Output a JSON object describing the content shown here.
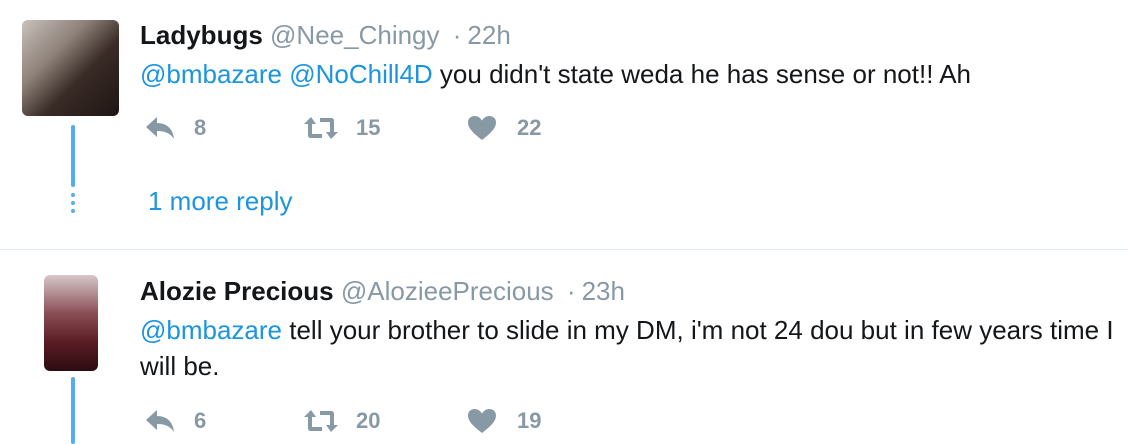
{
  "tweets": [
    {
      "name": "Ladybugs",
      "handle": "@Nee_Chingy",
      "separator": "·",
      "time": "22h",
      "mentions": [
        "@bmbazare",
        "@NoChill4D"
      ],
      "text": "you didn't state weda he has sense or not!! Ah",
      "replies": "8",
      "retweets": "15",
      "likes": "22",
      "more_replies": "1 more reply"
    },
    {
      "name": "Alozie Precious",
      "handle": "@AlozieePrecious",
      "separator": "·",
      "time": "23h",
      "mentions": [
        "@bmbazare"
      ],
      "text": "tell your brother to slide in my DM, i'm not 24 dou but in few years time I will be.",
      "replies": "6",
      "retweets": "20",
      "likes": "19"
    }
  ],
  "colors": {
    "link": "#1b95e0",
    "thread_line": "#55acee",
    "muted": "#8899a6",
    "text": "#14171a",
    "divider": "#e1e8ed"
  },
  "icons": [
    "reply-icon",
    "retweet-icon",
    "heart-icon"
  ]
}
